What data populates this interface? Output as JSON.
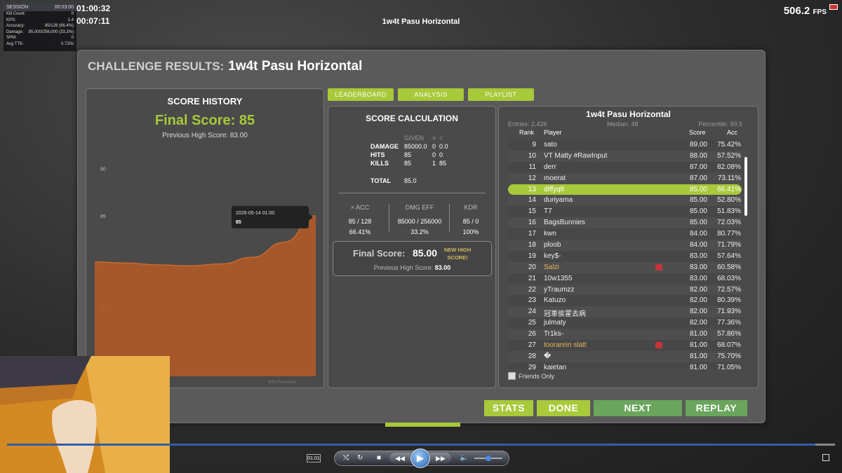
{
  "hud": {
    "title": "SESSION",
    "time": "00:03:00",
    "rows": [
      {
        "label": "Kill Count:",
        "value": "0"
      },
      {
        "label": "KPS:",
        "value": "1.4"
      },
      {
        "label": "Accuracy:",
        "value": "85/128 (66.4%)"
      },
      {
        "label": "Damage:",
        "value": "85,000/256,000 (33.2%)"
      },
      {
        "label": "SPM:",
        "value": "0"
      },
      {
        "label": "Avg TTK:",
        "value": "0.720s"
      }
    ],
    "timer_main": "01:00:32",
    "timer_sub": "00:07:11"
  },
  "top_title": "1w4t Pasu Horizontal",
  "fps": {
    "value": "506.2",
    "unit": "FPS"
  },
  "panel": {
    "label": "CHALLENGE RESULTS:",
    "scenario": "1w4t Pasu Horizontal"
  },
  "history": {
    "title": "SCORE HISTORY",
    "final": "Final Score: 85",
    "previous": "Previous High Score: 83.00",
    "tooltip_date": "2026-05-14 01:00",
    "tooltip_value": "85",
    "percentile_label": "90th Percentile",
    "fill_color": "#b05a28"
  },
  "chart_data": {
    "type": "area",
    "x": [
      "",
      "",
      "",
      "",
      "",
      "",
      "",
      "2026-05-14 01:00"
    ],
    "values": [
      80.1,
      80.0,
      79.8,
      79.7,
      79.9,
      80.6,
      82.2,
      85.0
    ],
    "yticks": [
      90,
      85,
      80,
      75,
      70
    ],
    "ylim": [
      68,
      91
    ],
    "title": "SCORE HISTORY",
    "xlabel": "",
    "ylabel": ""
  },
  "tabs": {
    "leaderboard": "LEADERBOARD",
    "analysis": "ANALYSIS",
    "playlist": "PLAYLIST"
  },
  "calc": {
    "title": "SCORE CALCULATION",
    "given": "GIVEN",
    "times": "×",
    "equals": "=",
    "damage_label": "DAMAGE",
    "damage_given": "85000.0",
    "damage_mult": "0",
    "damage_result": "0.0",
    "hits_label": "HITS",
    "hits_given": "85",
    "hits_mult": "0",
    "hits_result": "0",
    "kills_label": "KILLS",
    "kills_given": "85",
    "kills_mult": "1",
    "kills_result": "85",
    "total_label": "TOTAL",
    "total_value": "85.0",
    "acc_label": "× ACC",
    "acc_top": "85 / 128",
    "acc_bottom": "66.41%",
    "dmg_label": "DMG EFF",
    "dmg_top": "85000 / 256000",
    "dmg_bottom": "33.2%",
    "kdr_label": "KDR",
    "kdr_top": "85 / 0",
    "kdr_bottom": "100%",
    "final_label": "Final Score:",
    "final_value": "85.00",
    "new_high": "NEW HIGH SCORE!",
    "prev_label": "Previous High Score:",
    "prev_value": "83.00"
  },
  "leaderboard": {
    "title": "1w4t Pasu Horizontal",
    "entries": "Entries: 2,426",
    "median": "Median: 48",
    "percentile": "Percentile: 99.5",
    "col_rank": "Rank",
    "col_player": "Player",
    "col_score": "Score",
    "col_acc": "Acc",
    "rows": [
      {
        "rank": "9",
        "player": "sato",
        "score": "89.00",
        "acc": "75.42%"
      },
      {
        "rank": "10",
        "player": "VT Matty #RawInput",
        "score": "88.00",
        "acc": "57.52%"
      },
      {
        "rank": "11",
        "player": "derr",
        "score": "87.00",
        "acc": "82.08%"
      },
      {
        "rank": "12",
        "player": "moerat",
        "score": "87.00",
        "acc": "73.11%"
      },
      {
        "rank": "13",
        "player": "diffyqlt",
        "score": "85.00",
        "acc": "66.41%"
      },
      {
        "rank": "14",
        "player": "duriyama",
        "score": "85.00",
        "acc": "52.80%"
      },
      {
        "rank": "15",
        "player": "T7",
        "score": "85.00",
        "acc": "51.83%"
      },
      {
        "rank": "16",
        "player": "BagsBunnies",
        "score": "85.00",
        "acc": "72.03%"
      },
      {
        "rank": "17",
        "player": "kwn",
        "score": "84.00",
        "acc": "80.77%"
      },
      {
        "rank": "18",
        "player": "ploob",
        "score": "84.00",
        "acc": "71.79%"
      },
      {
        "rank": "19",
        "player": "key$-",
        "score": "83.00",
        "acc": "57.64%"
      },
      {
        "rank": "20",
        "player": "Salzi",
        "score": "83.00",
        "acc": "60.58%"
      },
      {
        "rank": "21",
        "player": "10w1355",
        "score": "83.00",
        "acc": "68.03%"
      },
      {
        "rank": "22",
        "player": "yTraumzz",
        "score": "82.00",
        "acc": "72.57%"
      },
      {
        "rank": "23",
        "player": "Katuzo",
        "score": "82.00",
        "acc": "80.39%"
      },
      {
        "rank": "24",
        "player": "冠軍侯霍去病",
        "score": "82.00",
        "acc": "71.93%"
      },
      {
        "rank": "25",
        "player": "julmaty",
        "score": "82.00",
        "acc": "77.36%"
      },
      {
        "rank": "26",
        "player": "Tr1ks-",
        "score": "81.00",
        "acc": "57.86%"
      },
      {
        "rank": "27",
        "player": "toorarein slatt",
        "score": "81.00",
        "acc": "68.07%"
      },
      {
        "rank": "28",
        "player": "�",
        "score": "81.00",
        "acc": "75.70%"
      },
      {
        "rank": "29",
        "player": "kaietan",
        "score": "81.00",
        "acc": "71.05%"
      }
    ],
    "friends_only": "Friends Only"
  },
  "buttons": {
    "stats": "STATS",
    "done": "DONE",
    "next": "NEXT",
    "replay": "REPLAY"
  },
  "player": {
    "time": "01:01"
  },
  "colors": {
    "accent": "#a8c93a",
    "next_green": "#6aa55c",
    "highlight_name": "#e5b65e",
    "badge_red": "#c8333a"
  }
}
